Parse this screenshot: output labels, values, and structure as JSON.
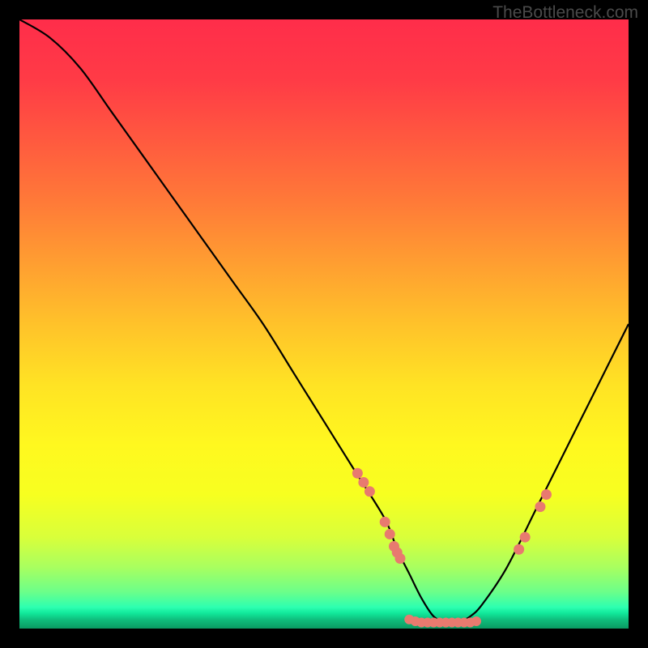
{
  "watermark": "TheBottleneck.com",
  "chart_data": {
    "type": "line",
    "title": "",
    "xlabel": "",
    "ylabel": "",
    "xlim": [
      0,
      100
    ],
    "ylim": [
      0,
      100
    ],
    "curve": {
      "x": [
        0,
        5,
        10,
        15,
        20,
        25,
        30,
        35,
        40,
        45,
        50,
        55,
        60,
        62,
        64,
        66,
        68,
        70,
        72,
        74,
        76,
        80,
        85,
        90,
        95,
        100
      ],
      "y": [
        100,
        97,
        92,
        85,
        78,
        71,
        64,
        57,
        50,
        42,
        34,
        26,
        18,
        13,
        9,
        5,
        2,
        1,
        1,
        2,
        4,
        10,
        20,
        30,
        40,
        50
      ]
    },
    "markers_left": {
      "x": [
        55.5,
        56.5,
        57.5,
        60.0,
        60.8,
        61.5,
        62.0,
        62.5
      ],
      "y": [
        25.5,
        24.0,
        22.5,
        17.5,
        15.5,
        13.5,
        12.5,
        11.5
      ]
    },
    "markers_bottom": {
      "x": [
        64.0,
        65.0,
        66.0,
        67.0,
        68.0,
        69.0,
        70.0,
        71.0,
        72.0,
        73.0,
        74.0,
        75.0
      ],
      "y": [
        1.5,
        1.2,
        1.0,
        1.0,
        1.0,
        1.0,
        1.0,
        1.0,
        1.0,
        1.0,
        1.0,
        1.2
      ]
    },
    "markers_right": {
      "x": [
        82.0,
        83.0,
        85.5,
        86.5
      ],
      "y": [
        13.0,
        15.0,
        20.0,
        22.0
      ]
    },
    "marker_color": "#e87a6f",
    "curve_color": "#000000",
    "gradient_stops": [
      {
        "offset": 0.0,
        "color": "#ff2d4a"
      },
      {
        "offset": 0.1,
        "color": "#ff3b46"
      },
      {
        "offset": 0.2,
        "color": "#ff5a3f"
      },
      {
        "offset": 0.3,
        "color": "#ff7a38"
      },
      {
        "offset": 0.4,
        "color": "#ff9e31"
      },
      {
        "offset": 0.5,
        "color": "#ffc22a"
      },
      {
        "offset": 0.6,
        "color": "#ffe324"
      },
      {
        "offset": 0.7,
        "color": "#fff81f"
      },
      {
        "offset": 0.78,
        "color": "#f7ff20"
      },
      {
        "offset": 0.85,
        "color": "#d9ff3a"
      },
      {
        "offset": 0.9,
        "color": "#a8ff60"
      },
      {
        "offset": 0.94,
        "color": "#6bff8a"
      },
      {
        "offset": 0.965,
        "color": "#2dffb0"
      },
      {
        "offset": 0.975,
        "color": "#10e89a"
      },
      {
        "offset": 0.985,
        "color": "#0fbf7d"
      },
      {
        "offset": 1.0,
        "color": "#0a9a62"
      }
    ]
  }
}
